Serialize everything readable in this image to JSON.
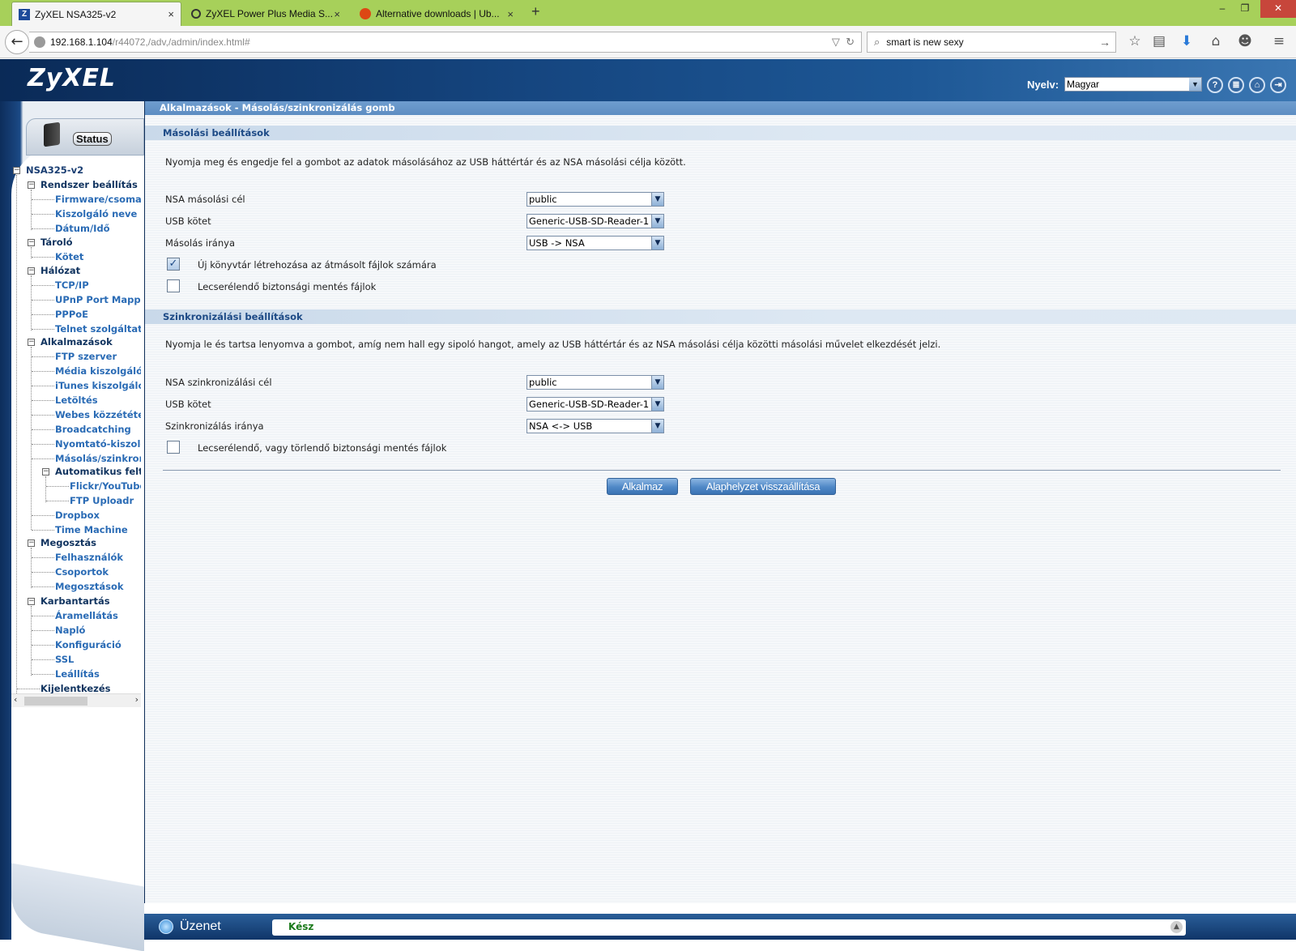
{
  "browser": {
    "tabs": [
      {
        "label": "ZyXEL NSA325-v2",
        "icon": "zyxel-z-icon",
        "active": true
      },
      {
        "label": "ZyXEL Power Plus Media S...",
        "icon": "forum-bubble-icon",
        "active": false
      },
      {
        "label": "Alternative downloads | Ub...",
        "icon": "ubuntu-icon",
        "active": false
      }
    ],
    "close_glyph": "×",
    "new_tab_glyph": "+",
    "window_controls": {
      "minimize": "–",
      "maximize": "❐",
      "close": "✕"
    },
    "url_host": "192.168.1.104",
    "url_path": "/r44072,/adv,/admin/index.html#",
    "search_value": "smart is new sexy",
    "toolbar_icons": [
      "star-icon",
      "reading-list-icon",
      "download-icon",
      "home-icon",
      "chat-icon",
      "menu-icon"
    ]
  },
  "header": {
    "logo": "ZyXEL",
    "language_label": "Nyelv:",
    "language_value": "Magyar",
    "icons": [
      "help-icon",
      "sitemap-icon",
      "home-icon",
      "logout-icon"
    ]
  },
  "sidebar": {
    "status_label": "Status",
    "tree": {
      "root": "NSA325-v2",
      "rendszer": "Rendszer beállítás",
      "firmware": "Firmware/csomag",
      "kiszolgalo_neve": "Kiszolgáló neve",
      "datum": "Dátum/Idő",
      "tarolo": "Tároló",
      "kotet": "Kötet",
      "halozat": "Hálózat",
      "tcpip": "TCP/IP",
      "upnp": "UPnP Port Mapping",
      "pppoe": "PPPoE",
      "telnet": "Telnet szolgáltatás",
      "alkalmazasok": "Alkalmazások",
      "ftp": "FTP szerver",
      "media": "Média kiszolgáló",
      "itunes": "iTunes kiszolgáló",
      "letoltes": "Letöltés",
      "webes": "Webes közzététel",
      "broadcatching": "Broadcatching",
      "nyomtato": "Nyomtató-kiszolgáló",
      "masolas": "Másolás/szinkronizálás",
      "automatikus": "Automatikus feltöltés",
      "flickr": "Flickr/YouTube",
      "ftp_uploadr": "FTP Uploadr",
      "dropbox": "Dropbox",
      "time_machine": "Time Machine",
      "megosztas": "Megosztás",
      "felhasznalok": "Felhasználók",
      "csoportok": "Csoportok",
      "megosztasok": "Megosztások",
      "karbantartas": "Karbantartás",
      "aramellatas": "Áramellátás",
      "naplo": "Napló",
      "konfiguracio": "Konfiguráció",
      "ssl": "SSL",
      "leallitas": "Leállítás",
      "kijelentkezes": "Kijelentkezés"
    }
  },
  "main": {
    "title": "Alkalmazások - Másolás/szinkronizálás gomb",
    "copy": {
      "heading": "Másolási beállítások",
      "description": "Nyomja meg és engedje fel a gombot az adatok másolásához az USB háttértár és az NSA másolási célja között.",
      "target_label": "NSA másolási cél",
      "target_value": "public",
      "usb_label": "USB kötet",
      "usb_value": "Generic-USB-SD-Reader-1",
      "direction_label": "Másolás iránya",
      "direction_value": "USB -> NSA",
      "newdir_label": "Új könyvtár létrehozása az átmásolt fájlok számára",
      "newdir_checked": true,
      "backup_label": "Lecserélendő biztonsági mentés fájlok",
      "backup_checked": false
    },
    "sync": {
      "heading": "Szinkronizálási beállítások",
      "description": "Nyomja le és tartsa lenyomva a gombot, amíg nem hall egy sipoló hangot, amely az USB háttértár és az NSA másolási célja közötti másolási művelet elkezdését jelzi.",
      "target_label": "NSA szinkronizálási cél",
      "target_value": "public",
      "usb_label": "USB kötet",
      "usb_value": "Generic-USB-SD-Reader-1",
      "direction_label": "Szinkronizálás iránya",
      "direction_value": "NSA <-> USB",
      "backup_label": "Lecserélendő, vagy törlendő biztonsági mentés fájlok",
      "backup_checked": false
    },
    "apply_label": "Alkalmaz",
    "reset_label": "Alaphelyzet visszaállítása"
  },
  "statusbar": {
    "message_label": "Üzenet",
    "message_text": "Kész"
  }
}
